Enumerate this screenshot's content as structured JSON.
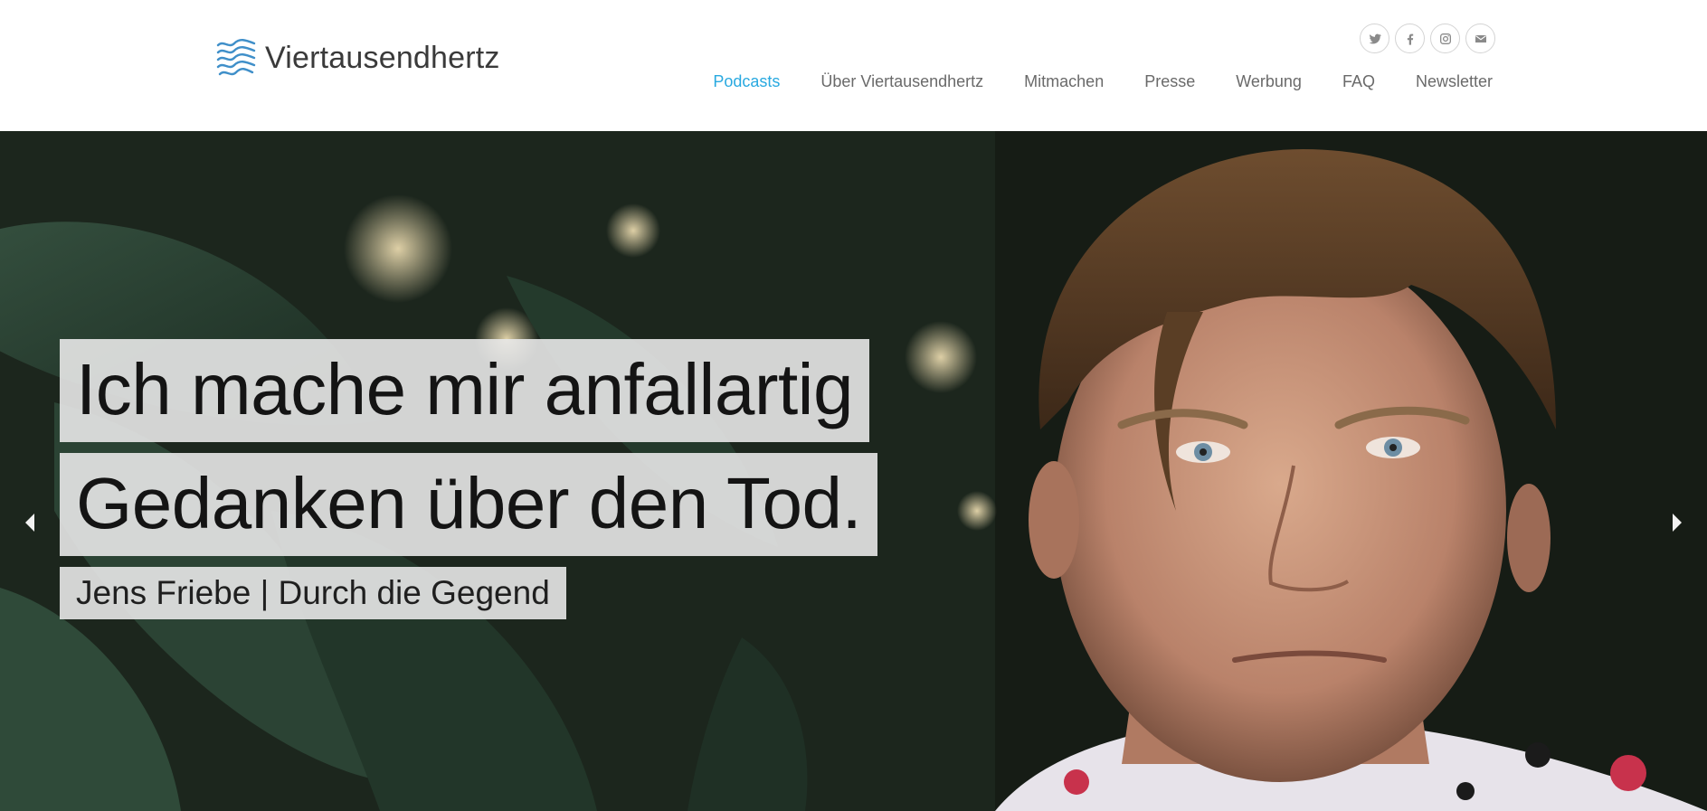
{
  "brand": {
    "name": "Viertausendhertz",
    "logo_icon": "wave-logo-icon",
    "accent_color": "#29a9e0"
  },
  "social": [
    {
      "icon": "twitter-icon"
    },
    {
      "icon": "facebook-icon"
    },
    {
      "icon": "instagram-icon"
    },
    {
      "icon": "mail-icon"
    }
  ],
  "nav": {
    "items": [
      {
        "label": "Podcasts",
        "active": true
      },
      {
        "label": "Über Viertausendhertz",
        "active": false
      },
      {
        "label": "Mitmachen",
        "active": false
      },
      {
        "label": "Presse",
        "active": false
      },
      {
        "label": "Werbung",
        "active": false
      },
      {
        "label": "FAQ",
        "active": false
      },
      {
        "label": "Newsletter",
        "active": false
      }
    ]
  },
  "hero": {
    "quote_line_1": "Ich mache mir anfallartig",
    "quote_line_2": "Gedanken über den Tod.",
    "subtitle": "Jens Friebe | Durch die Gegend",
    "prev_icon": "caret-left-icon",
    "next_icon": "caret-right-icon"
  }
}
